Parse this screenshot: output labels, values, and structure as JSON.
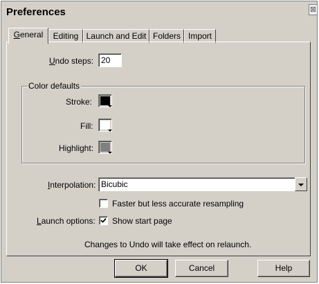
{
  "window": {
    "title": "Preferences",
    "close_glyph": "⊠"
  },
  "tabs": [
    {
      "label": "General",
      "mnemonic": "G",
      "rest": "eneral",
      "active": true
    },
    {
      "label": "Editing",
      "active": false
    },
    {
      "label": "Launch and Edit",
      "active": false
    },
    {
      "label": "Folders",
      "active": false
    },
    {
      "label": "Import",
      "active": false
    }
  ],
  "undo": {
    "label_mn": "U",
    "label_rest": "ndo steps:",
    "value": "20"
  },
  "color_defaults": {
    "title": "Color defaults",
    "stroke": {
      "label": "Stroke:",
      "color": "#000000"
    },
    "fill": {
      "label": "Fill:",
      "color": "#ffffff"
    },
    "highlight": {
      "label": "Highlight:",
      "color": "#808080"
    }
  },
  "interpolation": {
    "label_mn": "I",
    "label_rest": "nterpolation:",
    "value": "Bicubic"
  },
  "faster_resampling": {
    "label": "Faster but less accurate resampling",
    "checked": false
  },
  "launch_options": {
    "label_mn": "L",
    "label_rest": "aunch options:",
    "show_start_page_label": "Show start page",
    "checked": true
  },
  "notice": "Changes to Undo will take effect on relaunch.",
  "buttons": {
    "ok": "OK",
    "cancel": "Cancel",
    "help": "Help"
  }
}
